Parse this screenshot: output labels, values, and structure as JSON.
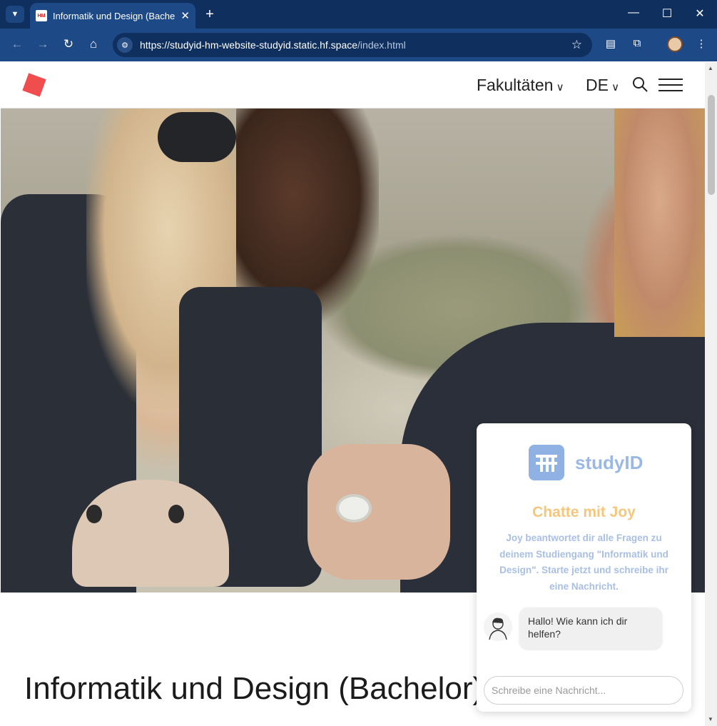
{
  "browser": {
    "tab_title": "Informatik und Design (Bachelor)",
    "favicon_text": "HM",
    "url_host": "https://studyid-hm-website-studyid.static.hf.space",
    "url_path": "/index.html"
  },
  "site": {
    "nav_faculties": "Fakultäten",
    "nav_language": "DE",
    "page_title": "Informatik und Design (Bachelor)"
  },
  "chat": {
    "brand": "studyID",
    "heading": "Chatte mit Joy",
    "description": "Joy beantwortet dir alle Fragen zu deinem Studiengang \"Informatik und Design\". Starte jetzt und schreibe ihr eine Nachricht.",
    "greeting": "Hallo! Wie kann ich dir helfen?",
    "input_placeholder": "Schreibe eine Nachricht..."
  },
  "colors": {
    "browser_dark": "#0f2f5e",
    "browser_toolbar": "#1d4a86",
    "logo_red": "#f04e4e",
    "chat_heading": "#f6c77a",
    "chat_blue": "#9ab8e6"
  }
}
